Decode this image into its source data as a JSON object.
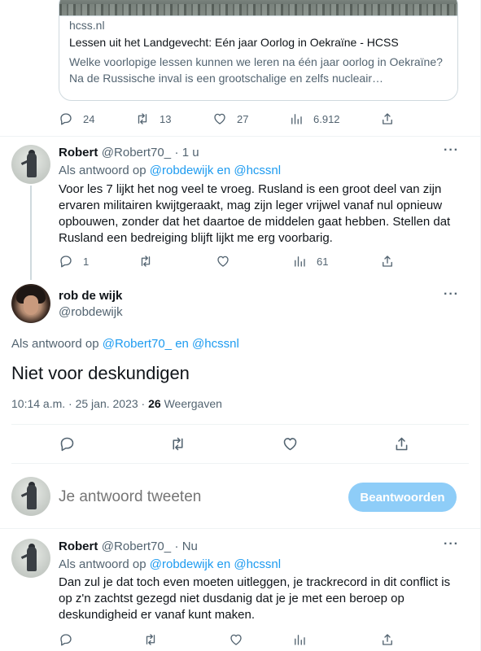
{
  "link_card": {
    "domain": "hcss.nl",
    "title": "Lessen uit het Landgevecht: Eén jaar Oorlog in Oekraïne - HCSS",
    "description": "Welke voorlopige lessen kunnen we leren na één jaar oorlog in Oekraïne? Na de Russische inval is een grootschalige en zelfs nucleair…"
  },
  "top_actions": {
    "replies": "24",
    "retweets": "13",
    "likes": "27",
    "views": "6.912"
  },
  "reply1": {
    "name": "Robert",
    "handle": "@Robert70_",
    "time": "· 1 u",
    "reply_prefix": "Als antwoord op",
    "reply_users": "@robdewijk en @hcssnl",
    "text": "Voor les 7 lijkt het nog veel te vroeg. Rusland is een groot deel van zijn ervaren militairen kwijtgeraakt, mag zijn leger vrijwel vanaf nul opnieuw opbouwen, zonder dat het daartoe de middelen gaat hebben. Stellen dat Rusland een bedreiging blijft lijkt me erg voorbarig.",
    "replies": "1",
    "views": "61"
  },
  "main_tweet": {
    "name": "rob de wijk",
    "handle": "@robdewijk",
    "reply_prefix": "Als antwoord op",
    "reply_users": "@Robert70_ en @hcssnl",
    "text": "Niet voor deskundigen",
    "timestamp": "10:14 a.m. · 25 jan. 2023 ·",
    "views_count": "26",
    "views_label": "Weergaven"
  },
  "composer": {
    "placeholder": "Je antwoord tweeten",
    "button": "Beantwoorden"
  },
  "reply2": {
    "name": "Robert",
    "handle": "@Robert70_",
    "time": "· Nu",
    "reply_prefix": "Als antwoord op",
    "reply_users": "@robdewijk en @hcssnl",
    "text": "Dan zul je dat toch even moeten uitleggen, je trackrecord in dit conflict is op z'n zachtst gezegd niet dusdanig dat je je met een beroep op deskundigheid er vanaf kunt maken."
  },
  "icons": [
    "reply-icon",
    "retweet-icon",
    "like-icon",
    "views-icon",
    "share-icon",
    "more-icon"
  ],
  "colors": {
    "accent": "#1d9bf0",
    "button_disabled": "#8ecdf8",
    "muted": "#536471",
    "border": "#eff3f4"
  }
}
